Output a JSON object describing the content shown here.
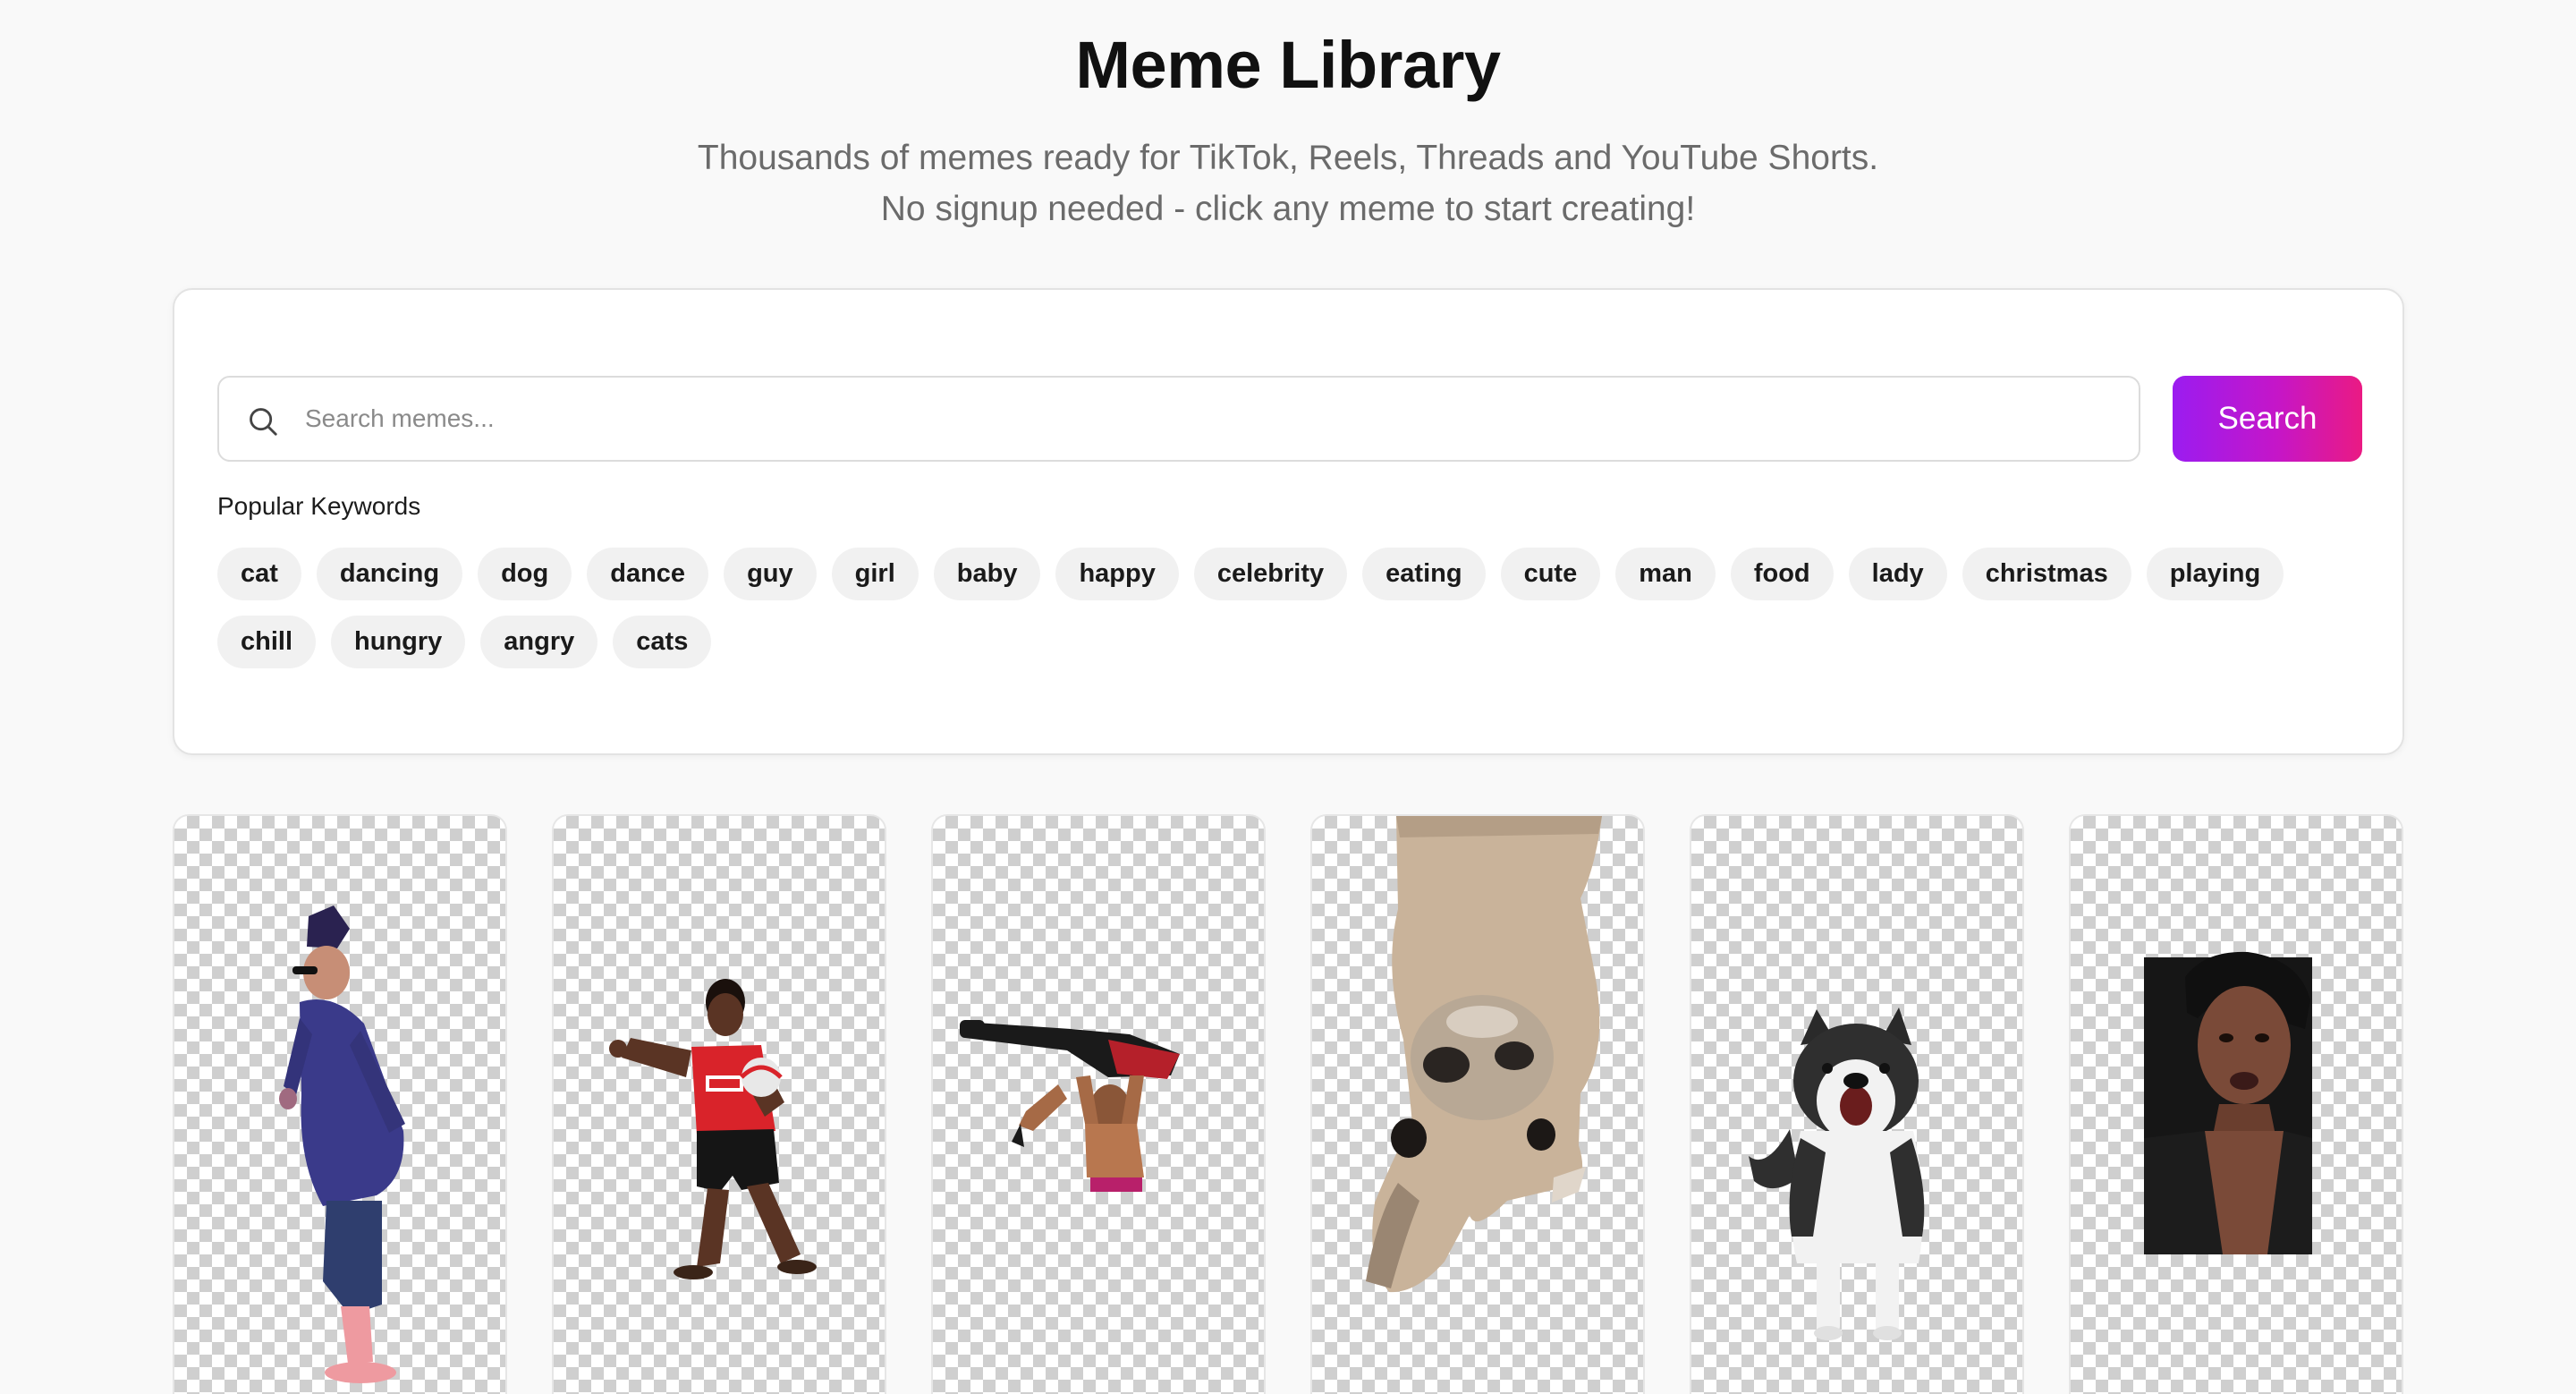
{
  "header": {
    "title": "Meme Library",
    "subtitle_line1": "Thousands of memes ready for TikTok, Reels, Threads and YouTube Shorts.",
    "subtitle_line2": "No signup needed - click any meme to start creating!"
  },
  "search": {
    "placeholder": "Search memes...",
    "value": "",
    "button_label": "Search",
    "icon": "search-icon"
  },
  "keywords": {
    "label": "Popular Keywords",
    "items": [
      "cat",
      "dancing",
      "dog",
      "dance",
      "guy",
      "girl",
      "baby",
      "happy",
      "celebrity",
      "eating",
      "cute",
      "man",
      "food",
      "lady",
      "christmas",
      "playing",
      "chill",
      "hungry",
      "angry",
      "cats"
    ]
  },
  "memes": [
    {
      "subject": "dancing-kid"
    },
    {
      "subject": "soccer-player"
    },
    {
      "subject": "wrestler-lift"
    },
    {
      "subject": "upside-down-llama"
    },
    {
      "subject": "husky-dog"
    },
    {
      "subject": "talking-woman"
    }
  ],
  "colors": {
    "accent_start": "#9b1cf0",
    "accent_end": "#ea1a83",
    "chip_bg": "#f1f1f1",
    "page_bg": "#f9f9f9"
  }
}
